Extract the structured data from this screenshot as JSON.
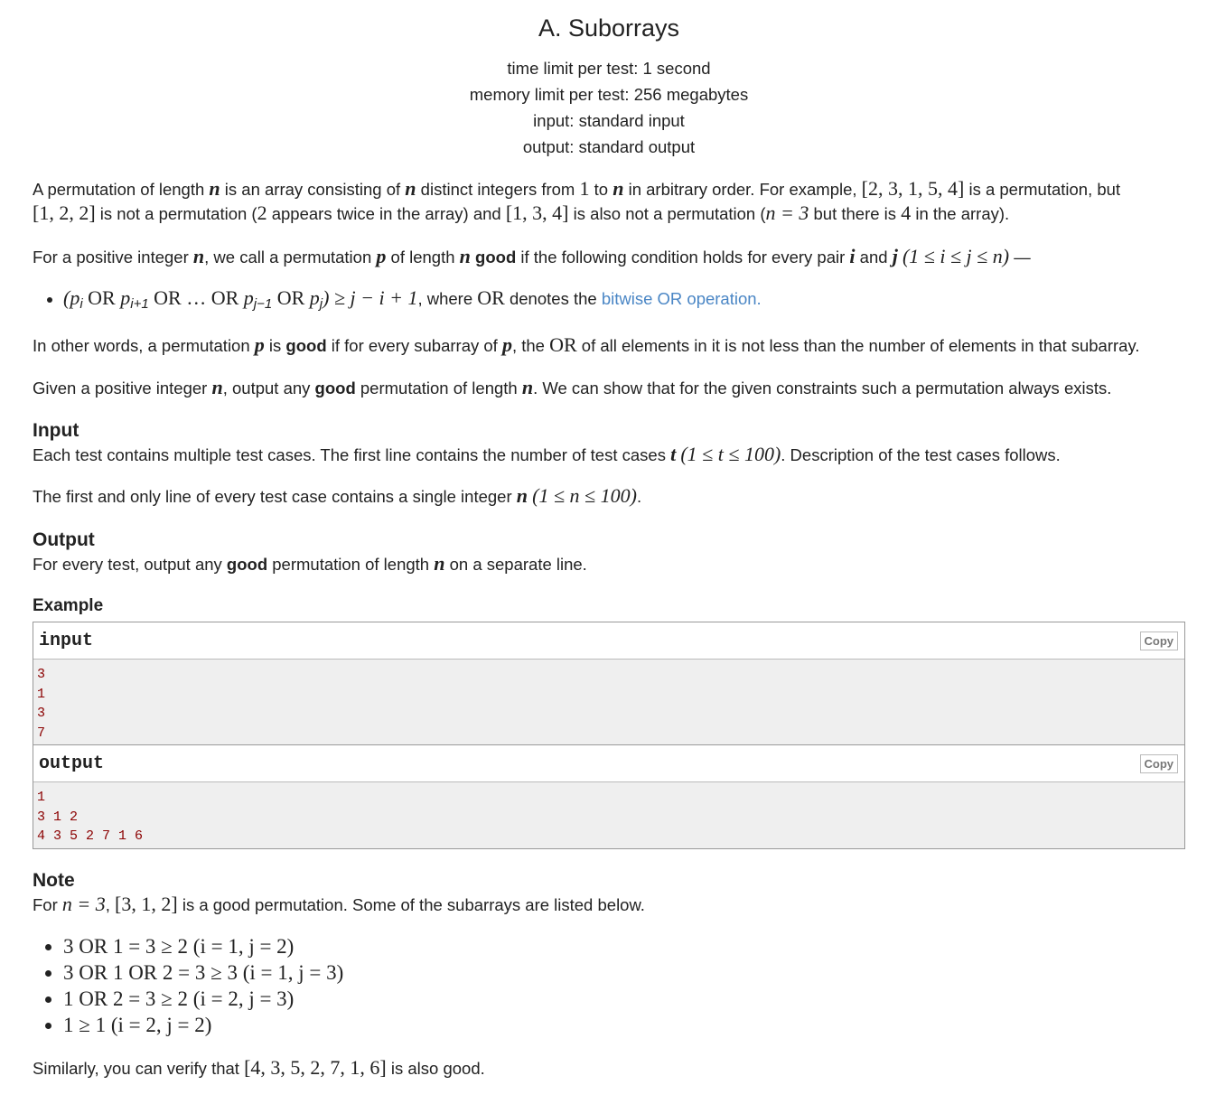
{
  "title": "A. Suborrays",
  "limits": {
    "time": "time limit per test: 1 second",
    "memory": "memory limit per test: 256 megabytes",
    "input": "input: standard input",
    "output": "output: standard output"
  },
  "statement": {
    "p1_a": "A permutation of length ",
    "p1_b": " is an array consisting of ",
    "p1_c": " distinct integers from ",
    "p1_d": " to ",
    "p1_e": " in arbitrary order. For example, ",
    "p1_f": " is a permutation, but ",
    "p1_g": " is not a permutation (",
    "p1_h": " appears twice in the array) and ",
    "p1_i": " is also not a permutation (",
    "p1_j": " but there is ",
    "p1_k": " in the array).",
    "p2_a": "For a positive integer ",
    "p2_b": ", we call a permutation ",
    "p2_c": " of length ",
    "p2_good": "good",
    "p2_d": " if the following condition holds for every pair ",
    "p2_e": " and ",
    "p2_f": " —",
    "bullet_where": ", where ",
    "bullet_denotes": " denotes the ",
    "bullet_link": "bitwise OR operation.",
    "p3_a": "In other words, a permutation ",
    "p3_b": " is ",
    "p3_good": "good",
    "p3_c": " if for every subarray of ",
    "p3_d": ", the ",
    "p3_e": " of all elements in it is not less than the number of elements in that subarray.",
    "p4_a": "Given a positive integer ",
    "p4_b": ", output any ",
    "p4_good": "good",
    "p4_c": " permutation of length ",
    "p4_d": ". We can show that for the given constraints such a permutation always exists."
  },
  "input_section": {
    "heading": "Input",
    "p1_a": "Each test contains multiple test cases. The first line contains the number of test cases ",
    "p1_b": ". Description of the test cases follows.",
    "p2_a": "The first and only line of every test case contains a single integer ",
    "p2_b": "."
  },
  "output_section": {
    "heading": "Output",
    "p_a": "For every test, output any ",
    "p_good": "good",
    "p_b": " permutation of length ",
    "p_c": " on a separate line."
  },
  "example": {
    "heading": "Example",
    "input_label": "input",
    "output_label": "output",
    "copy_label": "Copy",
    "input_lines": [
      "3",
      "1",
      "3",
      "7"
    ],
    "output_lines": [
      "1",
      "3 1 2",
      "4 3 5 2 7 1 6"
    ]
  },
  "note": {
    "heading": "Note",
    "p1_a": "For ",
    "p1_b": ", ",
    "p1_c": " is a good permutation. Some of the subarrays are listed below.",
    "items": [
      "3 OR 1 = 3 ≥ 2 (i = 1, j = 2)",
      "3 OR 1 OR 2 = 3 ≥ 3 (i = 1, j = 3)",
      "1 OR 2 = 3 ≥ 2 (i = 2, j = 3)",
      "1 ≥ 1 (i = 2, j = 2)"
    ],
    "p2_a": "Similarly, you can verify that ",
    "p2_b": " is also good."
  },
  "math": {
    "n": "n",
    "one": "1",
    "ex_perm": "[2, 3, 1, 5, 4]",
    "ex_bad1": "[1, 2, 2]",
    "two": "2",
    "ex_bad2": "[1, 3, 4]",
    "n_eq_3": "n = 3",
    "four": "4",
    "p": "p",
    "i": "i",
    "j": "j",
    "range_ij": "(1 ≤ i ≤ j ≤ n)",
    "cond_open": "(p",
    "sub_i": "i",
    "or": " OR ",
    "p_i1": "p",
    "sub_i1": "i+1",
    "dots": " OR … OR ",
    "p_j1": "p",
    "sub_j1": "j−1",
    "p_j": "p",
    "sub_j": "j",
    "cond_close": ") ≥ j − i + 1",
    "OR": "OR",
    "t": "t",
    "t_range": "(1 ≤ t ≤ 100)",
    "n_range": "(1 ≤ n ≤ 100)",
    "note_n": "n = 3",
    "note_perm": "[3, 1, 2]",
    "note_big": "[4, 3, 5, 2, 7, 1, 6]"
  }
}
